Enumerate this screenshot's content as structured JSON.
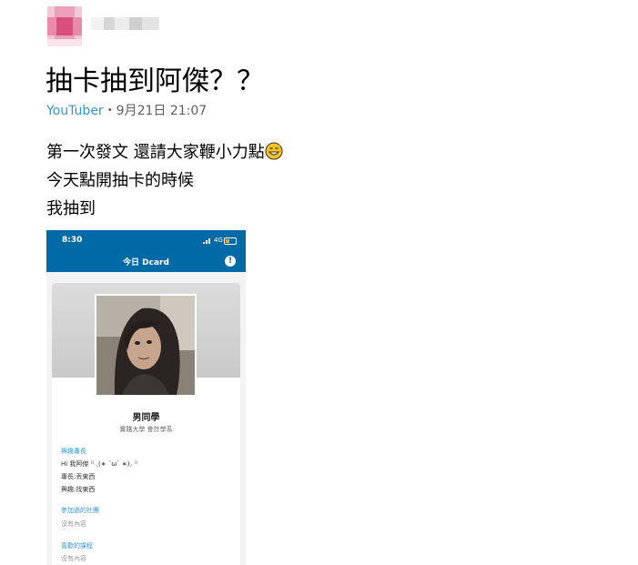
{
  "post": {
    "title": "抽卡抽到阿傑？？",
    "board": "YouTuber",
    "date": "・9月21日 21:07",
    "content_lines": [
      "第一次發文 還請大家鞭小力點",
      "今天點開抽卡的時候",
      "我抽到"
    ],
    "emoji": "grinning-sweat-emoji"
  },
  "screenshot": {
    "status_time": "8:30",
    "network": "4G",
    "nav_title": "今日 Dcard",
    "profile": {
      "name": "男同學",
      "school": "實踐大學 會計學系"
    },
    "sections": [
      {
        "title": "興趣專長",
        "lines": [
          "Hi 我阿傑 ⁽⁽ ◟(∗ ˊωˋ ∗)◞ ⁾⁾",
          "專長:丟東西",
          "興趣:找東西"
        ]
      },
      {
        "title": "參加過的社團",
        "lines": [
          "沒有內容"
        ]
      },
      {
        "title": "喜歡的課程",
        "lines": [
          "沒有內容"
        ]
      }
    ]
  },
  "colors": {
    "board": "#3397cf",
    "dcard_blue": "#006aa6"
  }
}
